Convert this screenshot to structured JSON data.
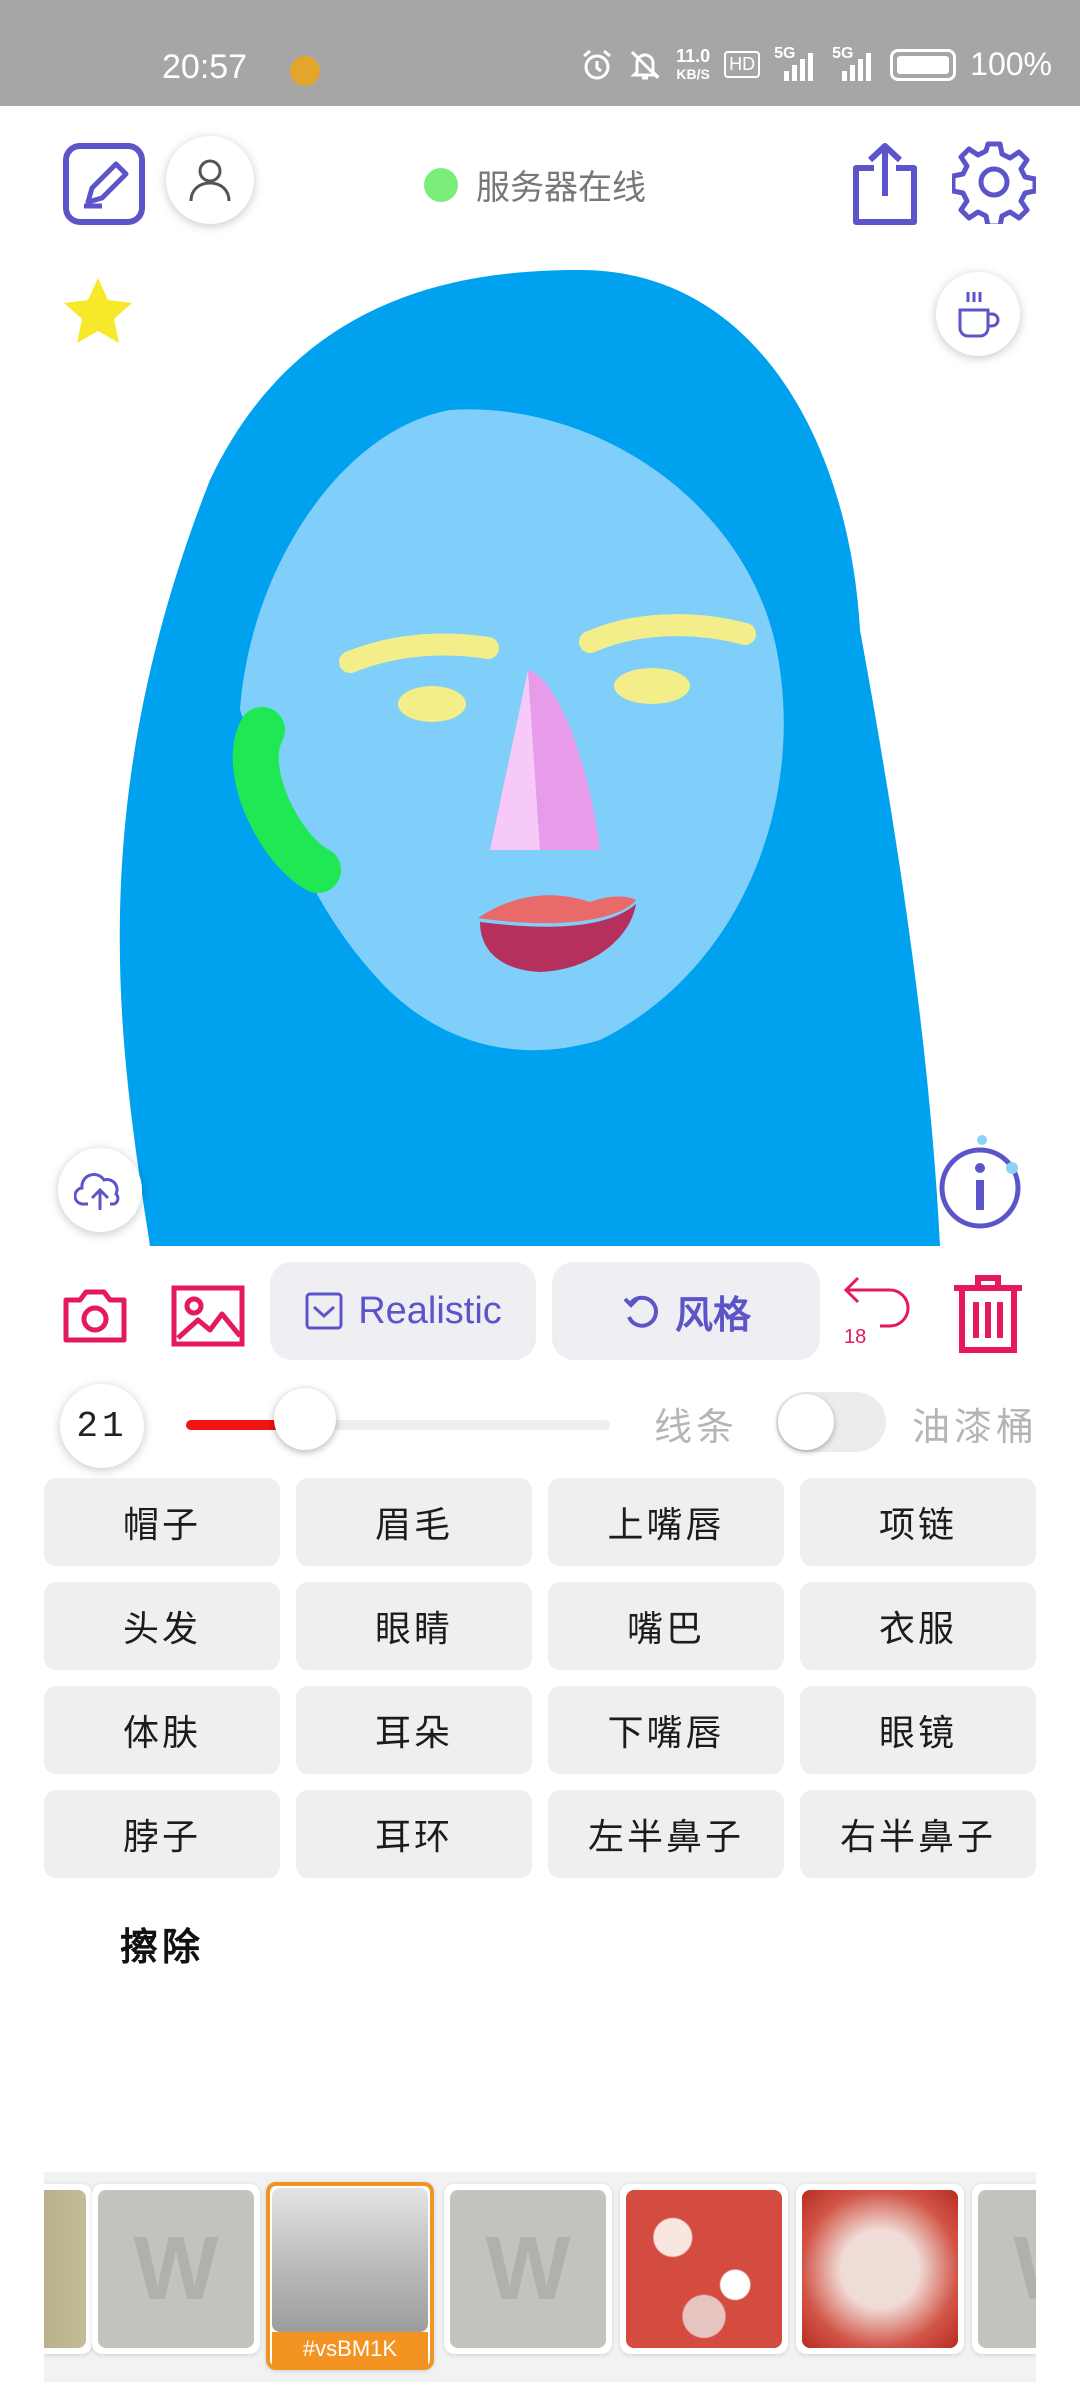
{
  "status_bar": {
    "time": "20:57",
    "net_speed_value": "11.0",
    "net_speed_unit": "KB/S",
    "hd_label": "HD",
    "sim1_label": "5G",
    "sim2_label": "5G",
    "battery": "100%"
  },
  "header": {
    "server_status": "服务器在线",
    "server_status_color": "#79ec79"
  },
  "toolbar": {
    "realistic_label": "Realistic",
    "style_label": "风格",
    "undo_count": "18",
    "accent_color": "#e4195f",
    "pill_text_color": "#5b55c9"
  },
  "brush": {
    "size": "21",
    "level": 0.28,
    "line_label": "线条",
    "bucket_label": "油漆桶",
    "bucket_on": false
  },
  "parts": [
    "帽子",
    "眉毛",
    "上嘴唇",
    "项链",
    "头发",
    "眼睛",
    "嘴巴",
    "衣服",
    "体肤",
    "耳朵",
    "下嘴唇",
    "眼镜",
    "脖子",
    "耳环",
    "左半鼻子",
    "右半鼻子"
  ],
  "erase_label": "擦除",
  "gallery": {
    "selected_caption": "#vsBM1K",
    "watermark": "W"
  }
}
